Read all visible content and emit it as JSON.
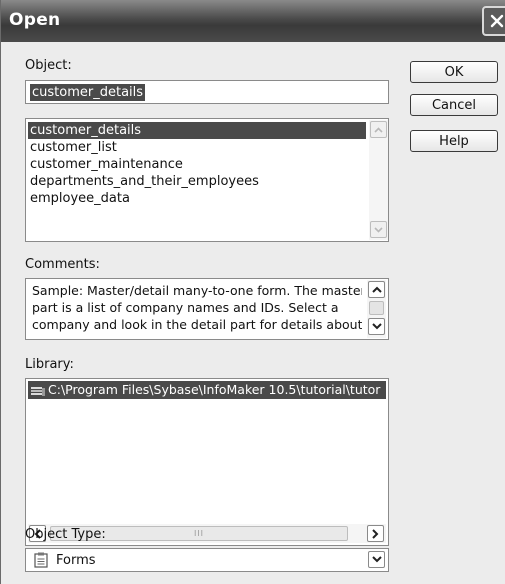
{
  "window": {
    "title": "Open",
    "close_glyph": "✕"
  },
  "object": {
    "label": "Object:",
    "value": "customer_details"
  },
  "object_list": {
    "items": [
      {
        "label": "customer_details",
        "selected": true
      },
      {
        "label": "customer_list",
        "selected": false
      },
      {
        "label": "customer_maintenance",
        "selected": false
      },
      {
        "label": "departments_and_their_employees",
        "selected": false
      },
      {
        "label": "employee_data",
        "selected": false
      }
    ]
  },
  "comments": {
    "label": "Comments:",
    "lines": [
      "Sample: Master/detail many-to-one form. The master",
      "part is a list of company names and IDs. Select a",
      "company and look in the detail part for details about"
    ]
  },
  "library": {
    "label": "Library:",
    "selected_path": "C:\\Program Files\\Sybase\\InfoMaker 10.5\\tutorial\\tutor",
    "icon": "library-icon",
    "scroll_thumb_glyph": "III"
  },
  "object_type": {
    "label": "Object Type:",
    "value": "Forms",
    "icon": "form-icon"
  },
  "buttons": {
    "ok": "OK",
    "cancel": "Cancel",
    "help": "Help"
  },
  "colors": {
    "title_bar": "#4a4a4a",
    "selection": "#4a4a4a",
    "dialog_bg": "#ececec"
  }
}
